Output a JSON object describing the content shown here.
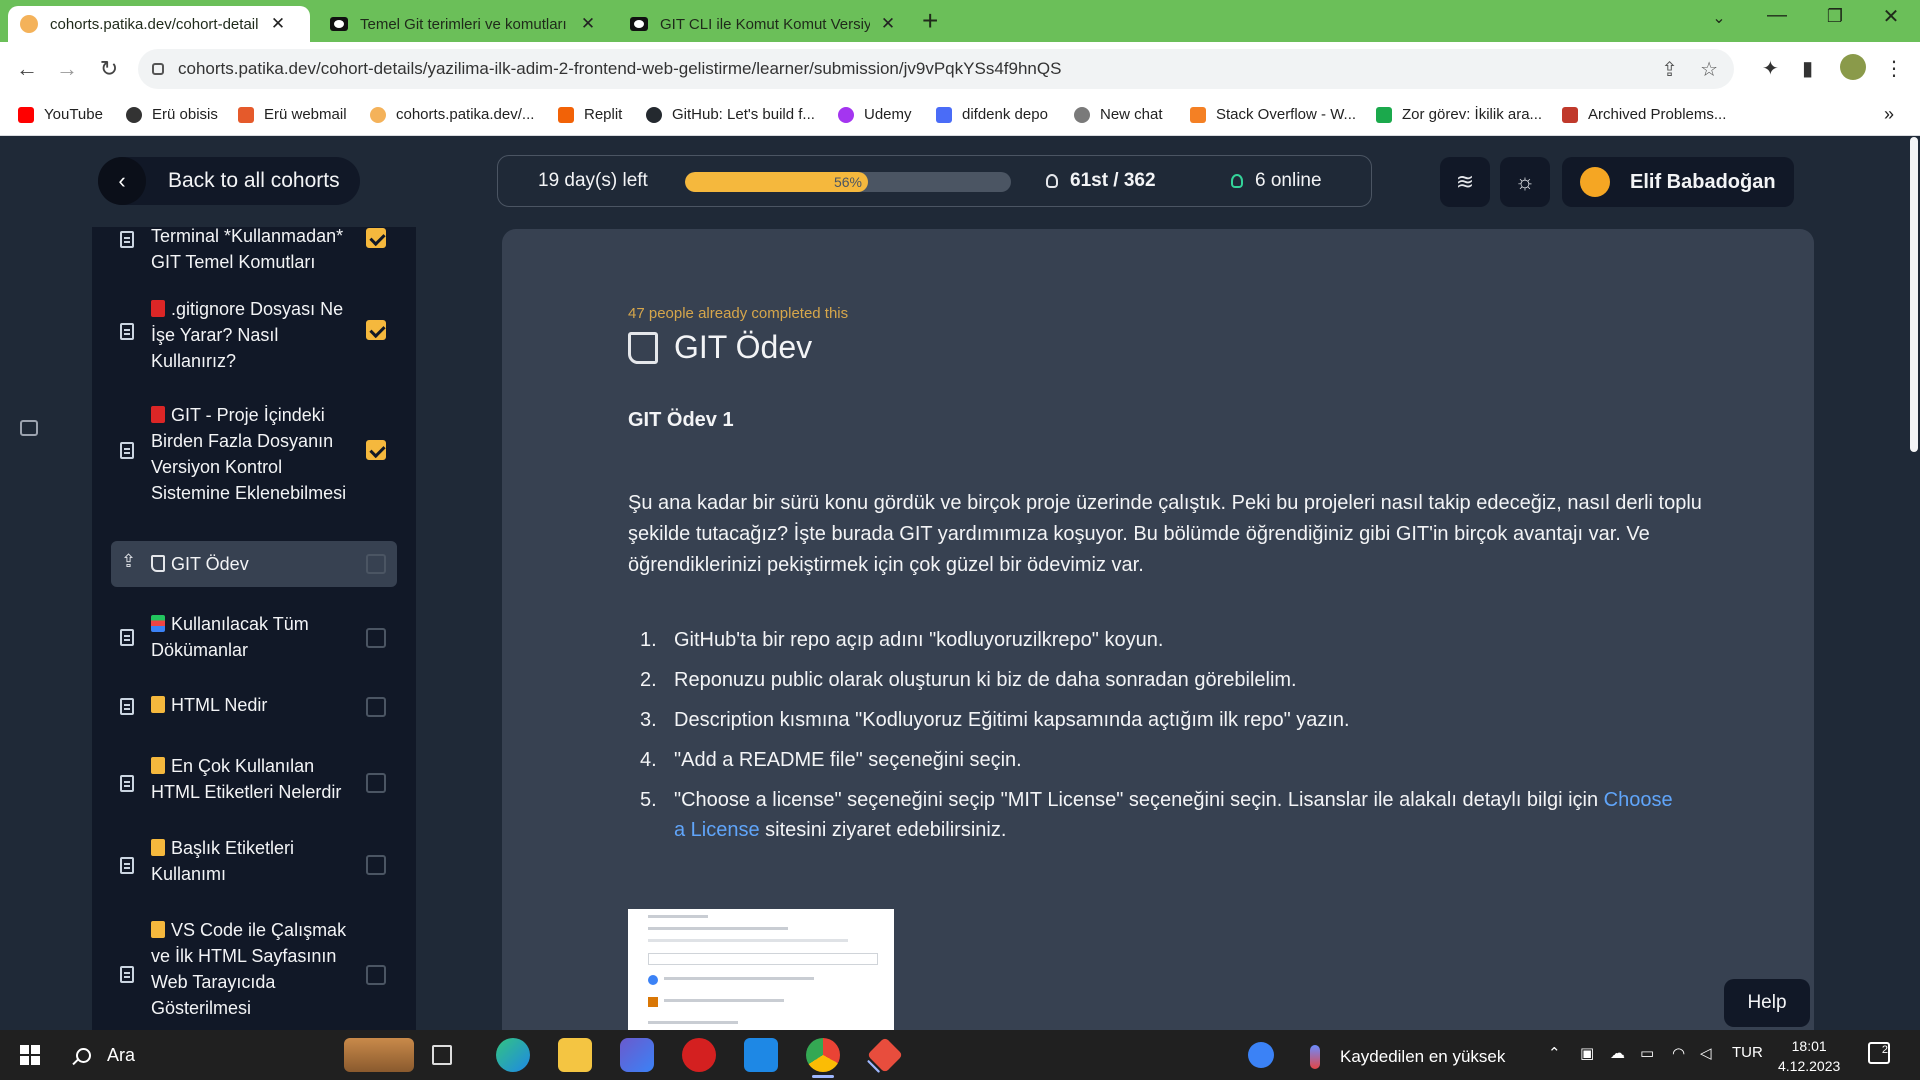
{
  "browser": {
    "tabs": [
      {
        "title": "cohorts.patika.dev/cohort-detail",
        "icon": "patika-favicon",
        "active": true
      },
      {
        "title": "Temel Git terimleri ve komutları",
        "icon": "youtube-favicon",
        "active": false
      },
      {
        "title": "GIT CLI ile Komut Komut Versiyo",
        "icon": "youtube-favicon",
        "active": false
      }
    ],
    "url": "cohorts.patika.dev/cohort-details/yazilima-ilk-adim-2-frontend-web-gelistirme/learner/submission/jv9vPqkYSs4f9hnQS",
    "bookmarks": [
      {
        "label": "YouTube",
        "color": "#ff0000"
      },
      {
        "label": "Erü obisis",
        "color": "#333333"
      },
      {
        "label": "Erü webmail",
        "color": "#e55a2b"
      },
      {
        "label": "cohorts.patika.dev/...",
        "color": "#f4b25a"
      },
      {
        "label": "Replit",
        "color": "#f26207"
      },
      {
        "label": "GitHub: Let's build f...",
        "color": "#24292f"
      },
      {
        "label": "Udemy",
        "color": "#a435f0"
      },
      {
        "label": "difdenk depo",
        "color": "#4a6cf7"
      },
      {
        "label": "New chat",
        "color": "#7a7a7a"
      },
      {
        "label": "Stack Overflow - W...",
        "color": "#f48024"
      },
      {
        "label": "Zor görev: İkilik ara...",
        "color": "#1ba94c"
      },
      {
        "label": "Archived Problems...",
        "color": "#c0392b"
      }
    ],
    "bookmarks_overflow": "»"
  },
  "header": {
    "back_label": "Back to all cohorts",
    "days_left": "19 day(s) left",
    "progress_percent": 56,
    "progress_label": "56%",
    "rank": "61st / 362",
    "online": "6 online",
    "user_name": "Elif Babadoğan"
  },
  "sidebar": {
    "items": [
      {
        "text": "Terminal *Kullanmadan* GIT Temel Komutları",
        "emoji": "",
        "checked": true
      },
      {
        "text": ".gitignore Dosyası Ne İşe Yarar? Nasıl Kullanırız?",
        "emoji": "red",
        "checked": true
      },
      {
        "text": "GIT - Proje İçindeki Birden Fazla Dosyanın Versiyon Kontrol Sistemine Eklenebilmesi",
        "emoji": "red",
        "checked": true
      },
      {
        "text": "GIT Ödev",
        "emoji": "boot",
        "checked": false,
        "current": true
      },
      {
        "text": "Kullanılacak Tüm Dökümanlar",
        "emoji": "books",
        "checked": false
      },
      {
        "text": "HTML Nedir",
        "emoji": "yel",
        "checked": false
      },
      {
        "text": "En Çok Kullanılan HTML Etiketleri Nelerdir",
        "emoji": "yel",
        "checked": false
      },
      {
        "text": "Başlık Etiketleri Kullanımı",
        "emoji": "yel",
        "checked": false
      },
      {
        "text": "VS Code ile Çalışmak ve İlk HTML Sayfasının Web Tarayıcıda Gösterilmesi",
        "emoji": "yel",
        "checked": false
      }
    ]
  },
  "content": {
    "completed_text": "47 people already completed this",
    "title": "GIT Ödev",
    "subtitle": "GIT Ödev 1",
    "intro": "Şu ana kadar bir sürü konu gördük ve birçok proje üzerinde çalıştık. Peki bu projeleri nasıl takip edeceğiz, nasıl derli toplu şekilde tutacağız? İşte burada GIT yardımımıza koşuyor. Bu bölümde öğrendiğiniz gibi GIT'in birçok avantajı var. Ve öğrendiklerinizi pekiştirmek için çok güzel bir ödevimiz var.",
    "steps": [
      {
        "num": "1.",
        "text": "GitHub'ta bir repo açıp adını \"kodluyoruzilkrepo\" koyun."
      },
      {
        "num": "2.",
        "text": "Reponuzu public olarak oluşturun ki biz de daha sonradan görebilelim."
      },
      {
        "num": "3.",
        "text": "Description kısmına \"Kodluyoruz Eğitimi kapsamında açtığım ilk repo\" yazın."
      },
      {
        "num": "4.",
        "text": "\"Add a README file\" seçeneğini seçin."
      },
      {
        "num": "5.",
        "text_before": "\"Choose a license\" seçeneğini seçip \"MIT License\" seçeneğini seçin. Lisanslar ile alakalı detaylı bilgi için ",
        "link": "Choose a License",
        "text_after": " sitesini ziyaret edebilirsiniz."
      }
    ],
    "help_label": "Help"
  },
  "taskbar": {
    "search_label": "Ara",
    "weather": "Kaydedilen en yüksek",
    "language": "TUR",
    "time": "18:01",
    "date": "4.12.2023",
    "notification_count": "2"
  }
}
